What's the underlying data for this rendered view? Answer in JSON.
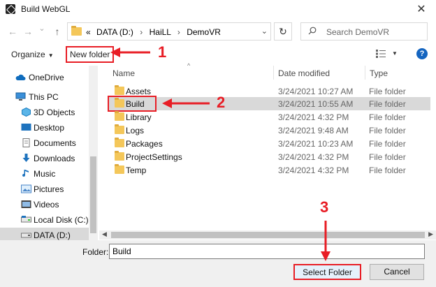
{
  "window": {
    "title": "Build WebGL",
    "close_glyph": "✕"
  },
  "nav": {
    "back_glyph": "←",
    "forward_glyph": "→",
    "recent_glyph": "⌄",
    "up_glyph": "↑",
    "path_prefix": "«",
    "path": [
      "DATA (D:)",
      "HaiLL",
      "DemoVR"
    ],
    "path_separator": "›",
    "dropdown_glyph": "⌄",
    "refresh_glyph": "↻",
    "search_placeholder": "Search DemoVR"
  },
  "toolbar": {
    "organize_label": "Organize",
    "caret": "▼",
    "new_folder_label": "New folder",
    "help_glyph": "?"
  },
  "sidebar": {
    "items": [
      {
        "label": "OneDrive",
        "icon": "cloud-icon"
      },
      {
        "label": "This PC",
        "icon": "computer-icon"
      },
      {
        "label": "3D Objects",
        "icon": "cube-icon"
      },
      {
        "label": "Desktop",
        "icon": "desktop-icon"
      },
      {
        "label": "Documents",
        "icon": "document-icon"
      },
      {
        "label": "Downloads",
        "icon": "download-icon"
      },
      {
        "label": "Music",
        "icon": "music-icon"
      },
      {
        "label": "Pictures",
        "icon": "pictures-icon"
      },
      {
        "label": "Videos",
        "icon": "video-icon"
      },
      {
        "label": "Local Disk (C:)",
        "icon": "disk-icon"
      },
      {
        "label": "DATA (D:)",
        "icon": "drive-icon"
      }
    ]
  },
  "file_list": {
    "columns": [
      "Name",
      "Date modified",
      "Type"
    ],
    "sort_glyph": "^",
    "rows": [
      {
        "name": "Assets",
        "date": "3/24/2021 10:27 AM",
        "type": "File folder"
      },
      {
        "name": "Build",
        "date": "3/24/2021 10:55 AM",
        "type": "File folder",
        "selected": true
      },
      {
        "name": "Library",
        "date": "3/24/2021 4:32 PM",
        "type": "File folder"
      },
      {
        "name": "Logs",
        "date": "3/24/2021 9:48 AM",
        "type": "File folder"
      },
      {
        "name": "Packages",
        "date": "3/24/2021 10:23 AM",
        "type": "File folder"
      },
      {
        "name": "ProjectSettings",
        "date": "3/24/2021 4:32 PM",
        "type": "File folder"
      },
      {
        "name": "Temp",
        "date": "3/24/2021 4:32 PM",
        "type": "File folder"
      }
    ]
  },
  "scroll": {
    "left_glyph": "◀",
    "right_glyph": "▶"
  },
  "footer": {
    "folder_label": "Folder:",
    "folder_value": "Build",
    "select_label": "Select Folder",
    "cancel_label": "Cancel"
  },
  "annotations": {
    "step1": "1",
    "step2": "2",
    "step3": "3",
    "color": "#e81d25"
  }
}
